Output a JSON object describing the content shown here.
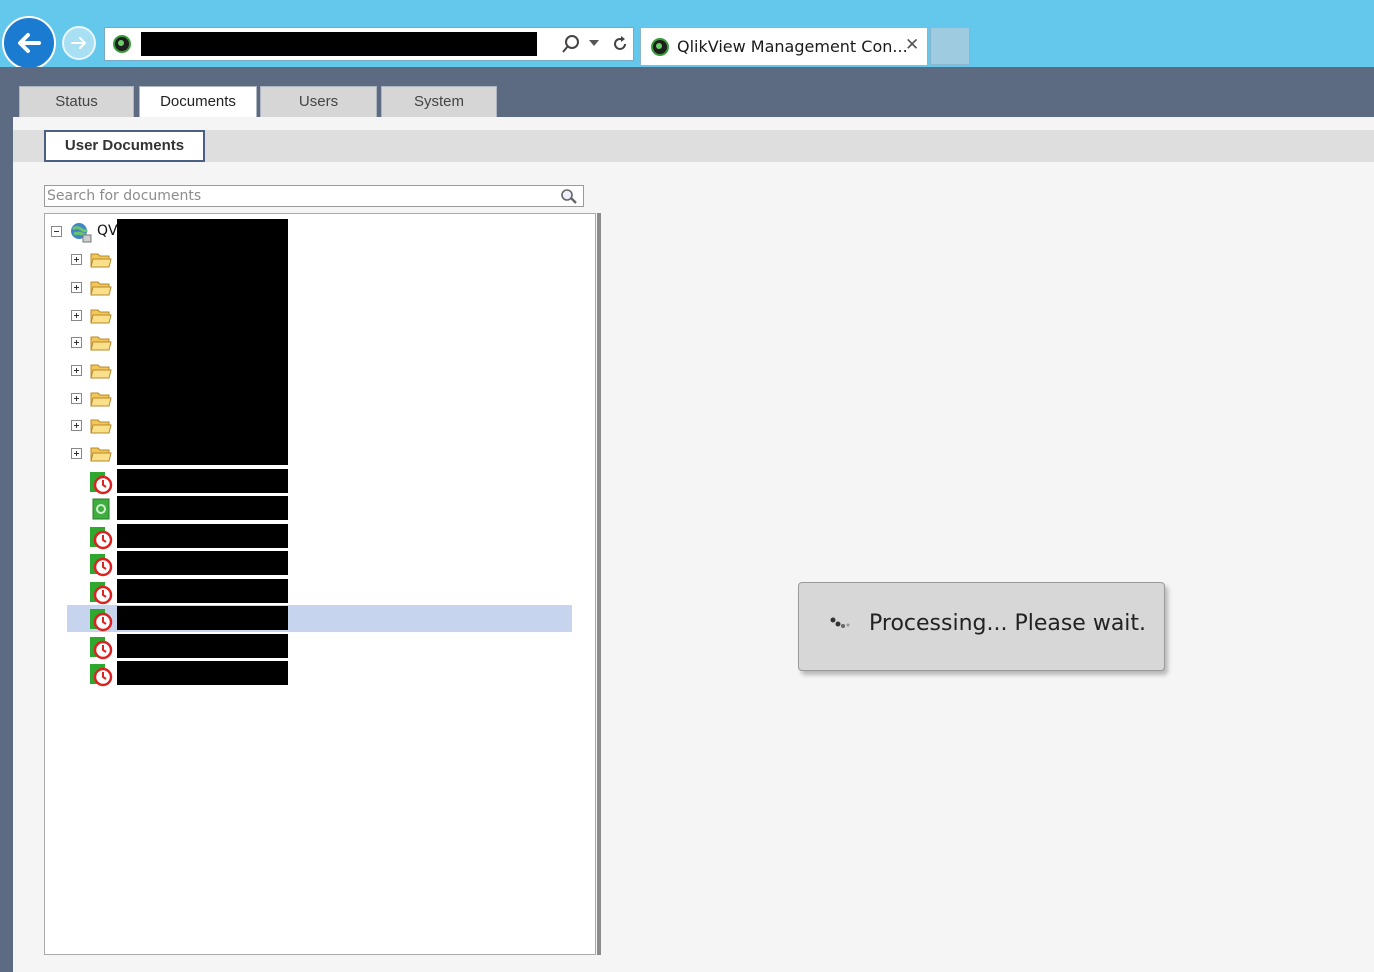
{
  "browser": {
    "tab_title": "QlikView Management Con...",
    "tab_close": "✕"
  },
  "app_tabs": [
    {
      "label": "Status",
      "active": false
    },
    {
      "label": "Documents",
      "active": true
    },
    {
      "label": "Users",
      "active": false
    },
    {
      "label": "System",
      "active": false
    }
  ],
  "subtab": {
    "label": "User Documents"
  },
  "search": {
    "placeholder": "Search for documents"
  },
  "tree": {
    "root_label": "QV",
    "folder_count_label": "",
    "items": [
      {
        "type": "folder"
      },
      {
        "type": "folder"
      },
      {
        "type": "folder"
      },
      {
        "type": "folder"
      },
      {
        "type": "folder"
      },
      {
        "type": "folder"
      },
      {
        "type": "folder"
      },
      {
        "type": "folder"
      },
      {
        "type": "document-with-task"
      },
      {
        "type": "document"
      },
      {
        "type": "document-with-task"
      },
      {
        "type": "document-with-task"
      },
      {
        "type": "document-with-task"
      },
      {
        "type": "document-with-task",
        "selected": true
      },
      {
        "type": "document-with-task"
      },
      {
        "type": "document-with-task"
      }
    ]
  },
  "dialog": {
    "message": "Processing... Please wait."
  },
  "colors": {
    "browser_bar": "#63c8ec",
    "app_nav": "#5c6b81",
    "selection": "#c6d4ee",
    "subtab_border": "#4a5e86"
  }
}
